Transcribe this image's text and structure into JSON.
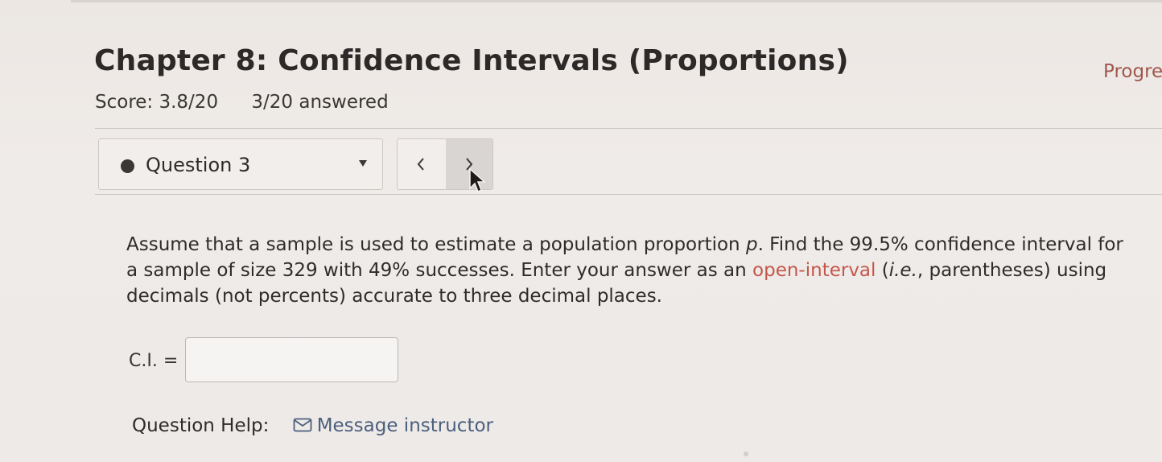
{
  "header": {
    "title": "Chapter 8: Confidence Intervals (Proportions)",
    "progress_label": "Progre",
    "score": "Score: 3.8/20",
    "answered": "3/20 answered"
  },
  "question_nav": {
    "selected_question": "Question 3",
    "prev_icon": "chevron-left-icon",
    "next_icon": "chevron-right-icon"
  },
  "question": {
    "text_before_link": "Assume that a sample is used to estimate a population proportion ",
    "variable": "p",
    "text_after_variable": ". Find the 99.5% confidence interval for a sample of size 329 with 49% successes. Enter your answer as an ",
    "link": "open-interval",
    "text_space": " (",
    "ie": "i.e.",
    "text_after_ie": ", parentheses) using decimals (not percents) accurate to three decimal places."
  },
  "answer": {
    "label": "C.I. =",
    "value": "",
    "placeholder": ""
  },
  "help": {
    "label": "Question Help:",
    "message_link": "Message instructor",
    "icon": "envelope-icon"
  },
  "colors": {
    "link": "#c4574b",
    "message_link": "#4b5f7e",
    "progress_link": "#a0564d"
  }
}
